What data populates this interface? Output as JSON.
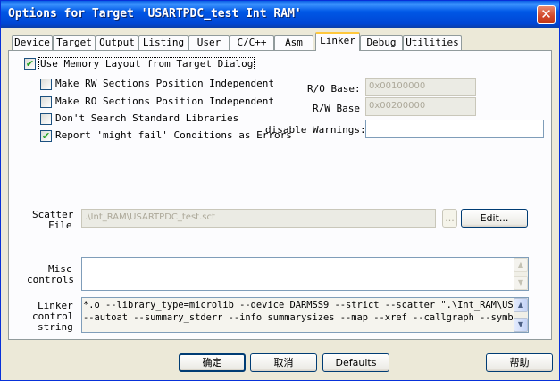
{
  "window": {
    "title": "Options for Target 'USARTPDC_test Int RAM'",
    "close_glyph": "✕"
  },
  "tabs": [
    "Device",
    "Target",
    "Output",
    "Listing",
    "User",
    "C/C++",
    "Asm",
    "Linker",
    "Debug",
    "Utilities"
  ],
  "active_tab": "Linker",
  "linker": {
    "use_memory_layout": {
      "label": "Use Memory Layout from Target Dialog",
      "checked": true
    },
    "make_rw": {
      "label": "Make RW Sections Position Independent",
      "checked": false
    },
    "make_ro": {
      "label": "Make RO Sections Position Independent",
      "checked": false
    },
    "dont_search": {
      "label": "Don't Search Standard Libraries",
      "checked": false
    },
    "report_might_fail": {
      "label": "Report 'might fail' Conditions as Errors",
      "checked": true
    },
    "ro_base": {
      "label": "R/O Base:",
      "value": "0x00100000"
    },
    "rw_base": {
      "label": "R/W Base",
      "value": "0x00200000"
    },
    "disable_warnings": {
      "label": "disable Warnings:",
      "value": ""
    },
    "scatter_file": {
      "label_line1": "Scatter",
      "label_line2": "File",
      "value": ".\\Int_RAM\\USARTPDC_test.sct",
      "browse_label": "...",
      "edit_label": "Edit..."
    },
    "misc_controls": {
      "label_line1": "Misc",
      "label_line2": "controls",
      "value": ""
    },
    "linker_control": {
      "label_line1": "Linker",
      "label_line2": "control",
      "label_line3": "string",
      "line1": "*.o --library_type=microlib --device DARMSS9 --strict --scatter \".\\Int_RAM\\USART",
      "line2": "--autoat --summary_stderr --info summarysizes --map --xref --callgraph --symbols"
    }
  },
  "footer": {
    "ok_label": "确定",
    "cancel_label": "取消",
    "defaults_label": "Defaults",
    "help_label": "帮助"
  },
  "colors": {
    "title_bar": "#0054e3",
    "dialog_bg": "#ece9d8",
    "panel_bg": "#fcfcfe",
    "close_red": "#d1472a",
    "tab_highlight": "#ffc83c"
  },
  "icons": {
    "check": "✔",
    "scroll_up": "▲",
    "scroll_down": "▼"
  }
}
